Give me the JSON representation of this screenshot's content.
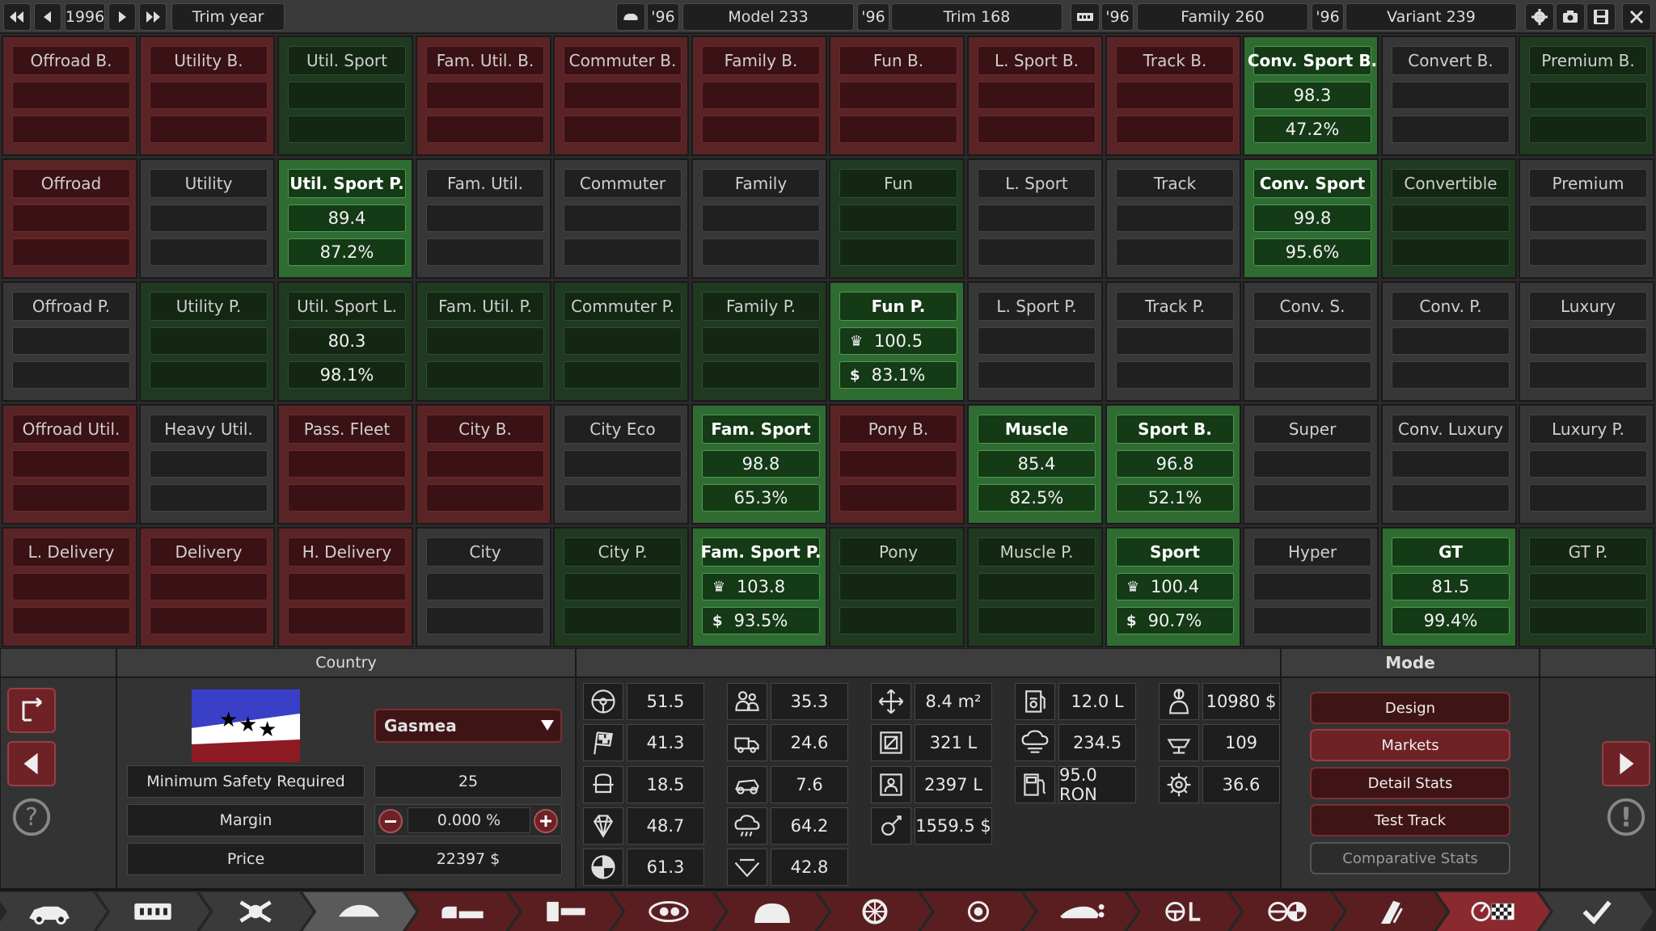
{
  "topbar": {
    "year": "1996",
    "trim_year_label": "Trim year",
    "model_year": "'96",
    "model": "Model 233",
    "trim_year": "'96",
    "trim": "Trim 168",
    "family_year": "'96",
    "family": "Family 260",
    "variant_year": "'96",
    "variant": "Variant 239"
  },
  "market_cells": [
    {
      "label": "Offroad B.",
      "style": "red",
      "v1": "",
      "v2": ""
    },
    {
      "label": "Utility B.",
      "style": "red",
      "v1": "",
      "v2": ""
    },
    {
      "label": "Util. Sport",
      "style": "dgreen",
      "v1": "",
      "v2": ""
    },
    {
      "label": "Fam. Util. B.",
      "style": "red",
      "v1": "",
      "v2": ""
    },
    {
      "label": "Commuter B.",
      "style": "red",
      "v1": "",
      "v2": ""
    },
    {
      "label": "Family B.",
      "style": "red",
      "v1": "",
      "v2": ""
    },
    {
      "label": "Fun B.",
      "style": "red",
      "v1": "",
      "v2": ""
    },
    {
      "label": "L. Sport B.",
      "style": "red",
      "v1": "",
      "v2": ""
    },
    {
      "label": "Track B.",
      "style": "red",
      "v1": "",
      "v2": ""
    },
    {
      "label": "Conv. Sport B.",
      "style": "green",
      "v1": "98.3",
      "v2": "47.2%"
    },
    {
      "label": "Convert B.",
      "style": "dark",
      "v1": "",
      "v2": ""
    },
    {
      "label": "Premium B.",
      "style": "dgreen",
      "v1": "",
      "v2": ""
    },
    {
      "label": "Offroad",
      "style": "red",
      "v1": "",
      "v2": ""
    },
    {
      "label": "Utility",
      "style": "dark",
      "v1": "",
      "v2": ""
    },
    {
      "label": "Util. Sport P.",
      "style": "green",
      "v1": "89.4",
      "v2": "87.2%"
    },
    {
      "label": "Fam. Util.",
      "style": "dark",
      "v1": "",
      "v2": ""
    },
    {
      "label": "Commuter",
      "style": "dark",
      "v1": "",
      "v2": ""
    },
    {
      "label": "Family",
      "style": "dark",
      "v1": "",
      "v2": ""
    },
    {
      "label": "Fun",
      "style": "dgreen",
      "v1": "",
      "v2": ""
    },
    {
      "label": "L. Sport",
      "style": "dark",
      "v1": "",
      "v2": ""
    },
    {
      "label": "Track",
      "style": "dark",
      "v1": "",
      "v2": ""
    },
    {
      "label": "Conv. Sport",
      "style": "green",
      "v1": "99.8",
      "v2": "95.6%"
    },
    {
      "label": "Convertible",
      "style": "dgreen",
      "v1": "",
      "v2": ""
    },
    {
      "label": "Premium",
      "style": "dark",
      "v1": "",
      "v2": ""
    },
    {
      "label": "Offroad P.",
      "style": "dark",
      "v1": "",
      "v2": ""
    },
    {
      "label": "Utility P.",
      "style": "dgreen",
      "v1": "",
      "v2": ""
    },
    {
      "label": "Util. Sport L.",
      "style": "dgreen",
      "v1": "80.3",
      "v2": "98.1%"
    },
    {
      "label": "Fam. Util. P.",
      "style": "dgreen",
      "v1": "",
      "v2": ""
    },
    {
      "label": "Commuter P.",
      "style": "dgreen",
      "v1": "",
      "v2": ""
    },
    {
      "label": "Family P.",
      "style": "dgreen",
      "v1": "",
      "v2": ""
    },
    {
      "label": "Fun P.",
      "style": "green",
      "v1": "100.5",
      "v2": "83.1%",
      "icons": true
    },
    {
      "label": "L. Sport P.",
      "style": "dark",
      "v1": "",
      "v2": ""
    },
    {
      "label": "Track P.",
      "style": "dark",
      "v1": "",
      "v2": ""
    },
    {
      "label": "Conv. S.",
      "style": "dark",
      "v1": "",
      "v2": ""
    },
    {
      "label": "Conv. P.",
      "style": "dark",
      "v1": "",
      "v2": ""
    },
    {
      "label": "Luxury",
      "style": "dark",
      "v1": "",
      "v2": ""
    },
    {
      "label": "Offroad Util.",
      "style": "red",
      "v1": "",
      "v2": ""
    },
    {
      "label": "Heavy Util.",
      "style": "dark",
      "v1": "",
      "v2": ""
    },
    {
      "label": "Pass. Fleet",
      "style": "red",
      "v1": "",
      "v2": ""
    },
    {
      "label": "City B.",
      "style": "red",
      "v1": "",
      "v2": ""
    },
    {
      "label": "City Eco",
      "style": "dark",
      "v1": "",
      "v2": ""
    },
    {
      "label": "Fam. Sport",
      "style": "green",
      "v1": "98.8",
      "v2": "65.3%"
    },
    {
      "label": "Pony B.",
      "style": "red",
      "v1": "",
      "v2": ""
    },
    {
      "label": "Muscle",
      "style": "green",
      "v1": "85.4",
      "v2": "82.5%"
    },
    {
      "label": "Sport B.",
      "style": "green",
      "v1": "96.8",
      "v2": "52.1%"
    },
    {
      "label": "Super",
      "style": "dark",
      "v1": "",
      "v2": ""
    },
    {
      "label": "Conv. Luxury",
      "style": "dark",
      "v1": "",
      "v2": ""
    },
    {
      "label": "Luxury P.",
      "style": "dark",
      "v1": "",
      "v2": ""
    },
    {
      "label": "L. Delivery",
      "style": "red",
      "v1": "",
      "v2": ""
    },
    {
      "label": "Delivery",
      "style": "red",
      "v1": "",
      "v2": ""
    },
    {
      "label": "H. Delivery",
      "style": "red",
      "v1": "",
      "v2": ""
    },
    {
      "label": "City",
      "style": "dark",
      "v1": "",
      "v2": ""
    },
    {
      "label": "City P.",
      "style": "dgreen",
      "v1": "",
      "v2": ""
    },
    {
      "label": "Fam. Sport P.",
      "style": "green",
      "v1": "103.8",
      "v2": "93.5%",
      "icons": true
    },
    {
      "label": "Pony",
      "style": "dgreen",
      "v1": "",
      "v2": ""
    },
    {
      "label": "Muscle P.",
      "style": "dgreen",
      "v1": "",
      "v2": ""
    },
    {
      "label": "Sport",
      "style": "green",
      "v1": "100.4",
      "v2": "90.7%",
      "icons": true
    },
    {
      "label": "Hyper",
      "style": "dark",
      "v1": "",
      "v2": ""
    },
    {
      "label": "GT",
      "style": "green",
      "v1": "81.5",
      "v2": "99.4%"
    },
    {
      "label": "GT P.",
      "style": "dgreen",
      "v1": "",
      "v2": ""
    }
  ],
  "country": {
    "header": "Country",
    "selected": "Gasmea",
    "min_safety_label": "Minimum Safety Required",
    "min_safety_value": "25",
    "margin_label": "Margin",
    "margin_value": "0.000 %",
    "price_label": "Price",
    "price_value": "22397 $"
  },
  "stats": {
    "col1": [
      "51.5",
      "41.3",
      "18.5",
      "48.7",
      "61.3"
    ],
    "col2": [
      "35.3",
      "24.6",
      "7.6",
      "64.2",
      "42.8"
    ],
    "col3": [
      "8.4 m²",
      "321 L",
      "2397 L",
      "1559.5 $"
    ],
    "col4": [
      "12.0 L",
      "234.5",
      "95.0 RON"
    ],
    "col5": [
      "10980 $",
      "109",
      "36.6"
    ]
  },
  "mode": {
    "header": "Mode",
    "buttons": [
      "Design",
      "Markets",
      "Detail Stats",
      "Test Track",
      "Comparative Stats"
    ]
  },
  "colors": {
    "accent_red": "#6e2226",
    "good_green": "#2f6c32",
    "panel_dark": "#333333"
  }
}
